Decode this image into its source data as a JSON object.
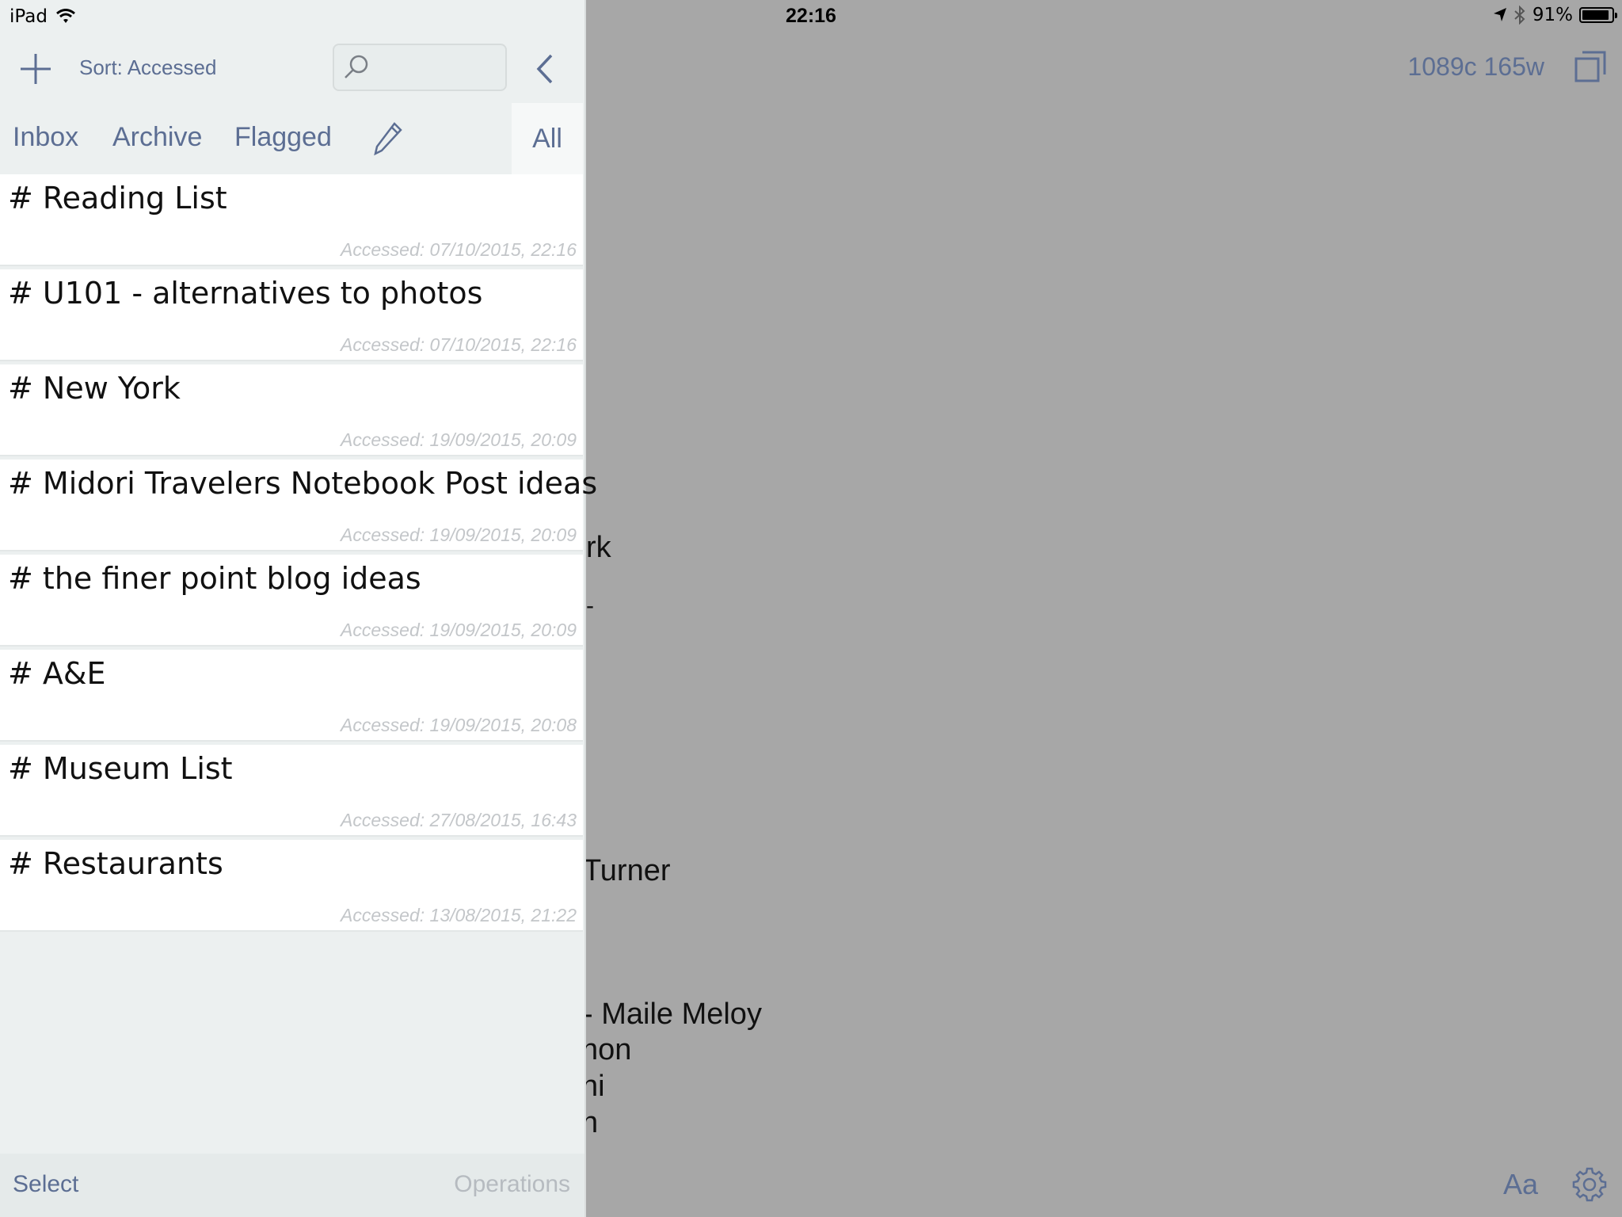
{
  "status_bar": {
    "device": "iPad",
    "time": "22:16",
    "battery": "91%",
    "battery_level": 0.91
  },
  "sidebar": {
    "add_icon": "plus-icon",
    "sort_label": "Sort: Accessed",
    "search": {
      "value": "",
      "placeholder": ""
    },
    "tabs": [
      {
        "label": "Inbox"
      },
      {
        "label": "Archive"
      },
      {
        "label": "Flagged"
      },
      {
        "label": "All",
        "selected": true
      }
    ],
    "notes": [
      {
        "title": "# Reading List",
        "accessed": "Accessed: 07/10/2015, 22:16"
      },
      {
        "title": "# U101 - alternatives to photos",
        "accessed": "Accessed: 07/10/2015, 22:16"
      },
      {
        "title": "# New York",
        "accessed": "Accessed: 19/09/2015, 20:09"
      },
      {
        "title": "# Midori Travelers Notebook Post ideas",
        "accessed": "Accessed: 19/09/2015, 20:09"
      },
      {
        "title": "# the finer point blog ideas",
        "accessed": "Accessed: 19/09/2015, 20:09"
      },
      {
        "title": "# A&E",
        "accessed": "Accessed: 19/09/2015, 20:08"
      },
      {
        "title": "# Museum List",
        "accessed": "Accessed: 27/08/2015, 16:43"
      },
      {
        "title": "# Restaurants",
        "accessed": "Accessed: 13/08/2015, 21:22"
      }
    ],
    "bottom": {
      "select_label": "Select",
      "operations_label": "Operations"
    }
  },
  "editor": {
    "word_count": "1089c 165w",
    "visible_text": [
      "rk",
      "-",
      "Turner",
      "- Maile Meloy",
      "non",
      "ni",
      "n"
    ],
    "font_button": "Aa"
  },
  "colors": {
    "accent": "#5c6e93",
    "sidebar_bg": "#ecf0f0",
    "editor_bg": "#a7a7a7"
  }
}
